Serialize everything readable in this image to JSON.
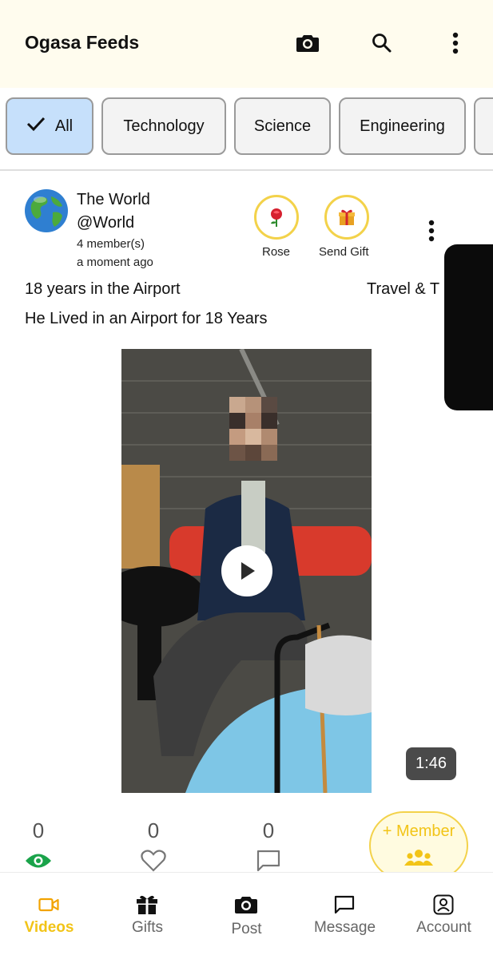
{
  "appbar": {
    "title": "Ogasa Feeds",
    "icons": [
      "camera-icon",
      "search-icon",
      "more-vertical-icon"
    ]
  },
  "categories": [
    {
      "label": "All",
      "selected": true,
      "icon": "check-icon"
    },
    {
      "label": "Technology",
      "selected": false
    },
    {
      "label": "Science",
      "selected": false
    },
    {
      "label": "Engineering",
      "selected": false
    }
  ],
  "post": {
    "channel_name": "The World",
    "handle": "@World",
    "members": "4 member(s)",
    "time": "a moment ago",
    "title": "18 years in the Airport",
    "category": "Travel & T",
    "description": "He Lived in an Airport for 18 Years",
    "gifts": [
      {
        "label": "Rose",
        "icon": "rose-icon"
      },
      {
        "label": "Send Gift",
        "icon": "gift-box-icon"
      }
    ],
    "video": {
      "duration": "1:46"
    }
  },
  "stats": {
    "views": "0",
    "likes": "0",
    "comments": "0",
    "member_button": "+ Member"
  },
  "colors": {
    "accent_yellow": "#f2c417",
    "chip_selected": "#c6e0fb",
    "appbar_bg": "#fffcee",
    "view_green": "#1aa34a"
  },
  "bottom_nav": [
    {
      "label": "Videos",
      "icon": "video-camera-icon",
      "active": true
    },
    {
      "label": "Gifts",
      "icon": "gift-icon",
      "active": false
    },
    {
      "label": "Post",
      "icon": "camera-icon",
      "active": false
    },
    {
      "label": "Message",
      "icon": "message-icon",
      "active": false
    },
    {
      "label": "Account",
      "icon": "account-icon",
      "active": false
    }
  ]
}
